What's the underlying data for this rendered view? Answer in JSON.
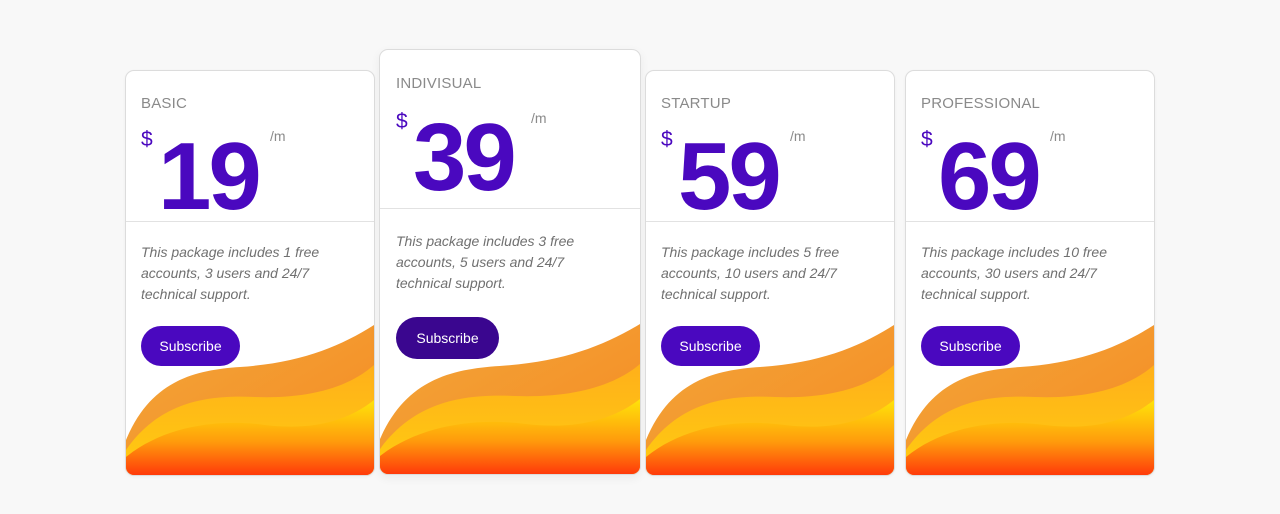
{
  "plans": [
    {
      "name": "BASIC",
      "currency": "$",
      "price": "19",
      "period": "/m",
      "description": "This package includes 1 free accounts, 3 users and 24/7 technical support.",
      "button_label": "Subscribe"
    },
    {
      "name": "INDIVISUAL",
      "currency": "$",
      "price": "39",
      "period": "/m",
      "description": "This package includes 3 free accounts, 5 users and 24/7 technical support.",
      "button_label": "Subscribe"
    },
    {
      "name": "STARTUP",
      "currency": "$",
      "price": "59",
      "period": "/m",
      "description": "This package includes 5 free accounts, 10 users and 24/7 technical support.",
      "button_label": "Subscribe"
    },
    {
      "name": "PROFESSIONAL",
      "currency": "$",
      "price": "69",
      "period": "/m",
      "description": "This package includes 10 free accounts, 30 users and 24/7 technical support.",
      "button_label": "Subscribe"
    }
  ],
  "colors": {
    "accent": "#4a08bf",
    "accent_featured_button": "#3a068f",
    "wave_orange": "#f2962e",
    "wave_yellow": "#ffd20a",
    "wave_red": "#ff3d0a"
  }
}
